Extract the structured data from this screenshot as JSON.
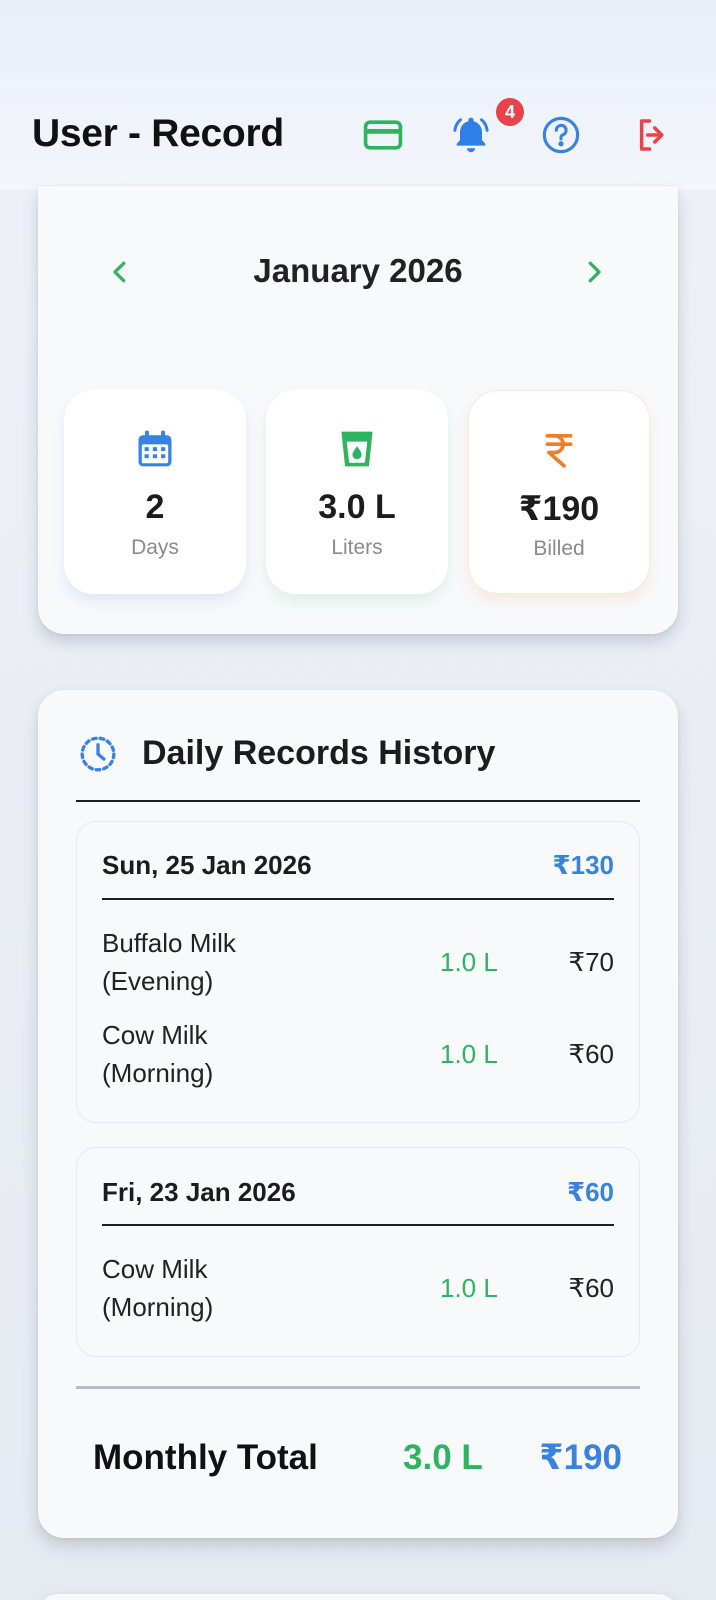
{
  "header": {
    "title": "User - Record",
    "notification_count": "4",
    "icons": [
      "card-icon",
      "bell-icon",
      "help-icon",
      "logout-icon"
    ]
  },
  "month_nav": {
    "label": "January 2026",
    "prev_icon": "chevron-left-icon",
    "next_icon": "chevron-right-icon"
  },
  "stats": {
    "days": {
      "value": "2",
      "label": "Days",
      "icon": "calendar-icon"
    },
    "liters": {
      "value": "3.0 L",
      "label": "Liters",
      "icon": "milk-glass-icon"
    },
    "billed": {
      "value": "₹190",
      "label": "Billed",
      "icon": "rupee-icon"
    }
  },
  "history": {
    "title": "Daily Records History",
    "icon": "history-clock-icon",
    "days": [
      {
        "date": "Sun, 25 Jan 2026",
        "total": "₹130",
        "entries": [
          {
            "name_line1": "Buffalo Milk",
            "name_line2": "(Evening)",
            "liters": "1.0 L",
            "amount": "₹70"
          },
          {
            "name_line1": "Cow Milk",
            "name_line2": "(Morning)",
            "liters": "1.0 L",
            "amount": "₹60"
          }
        ]
      },
      {
        "date": "Fri, 23 Jan 2026",
        "total": "₹60",
        "entries": [
          {
            "name_line1": "Cow Milk",
            "name_line2": "(Morning)",
            "liters": "1.0 L",
            "amount": "₹60"
          }
        ]
      }
    ]
  },
  "monthly_total": {
    "label": "Monthly Total",
    "liters": "3.0 L",
    "amount": "₹190"
  },
  "colors": {
    "green": "#2eb360",
    "blue": "#3a82e0",
    "orange": "#ef7d2a",
    "red": "#e8434a"
  }
}
